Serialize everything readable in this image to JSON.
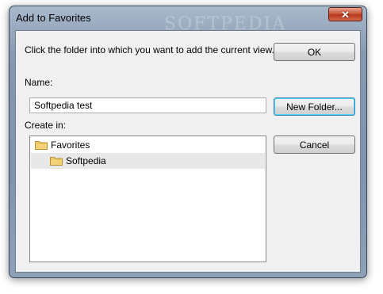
{
  "window": {
    "title": "Add to Favorites",
    "close_label": "✕"
  },
  "dialog": {
    "instruction": "Click the folder into which you want to add the current view.",
    "name_label": "Name:",
    "name_value": "Softpedia test",
    "create_in_label": "Create in:"
  },
  "buttons": {
    "ok": "OK",
    "new_folder": "New Folder...",
    "cancel": "Cancel"
  },
  "tree": {
    "items": [
      {
        "label": "Favorites",
        "icon": "folder-icon",
        "level": 0,
        "selected": false
      },
      {
        "label": "Softpedia",
        "icon": "folder-icon",
        "level": 1,
        "selected": true
      }
    ]
  },
  "watermark": "SOFTPEDIA",
  "colors": {
    "frame": "#8799b1",
    "client": "#f0f0f0",
    "selection": "#e8e8e8",
    "close": "#c85a3e",
    "focus": "#3c7fb1"
  }
}
